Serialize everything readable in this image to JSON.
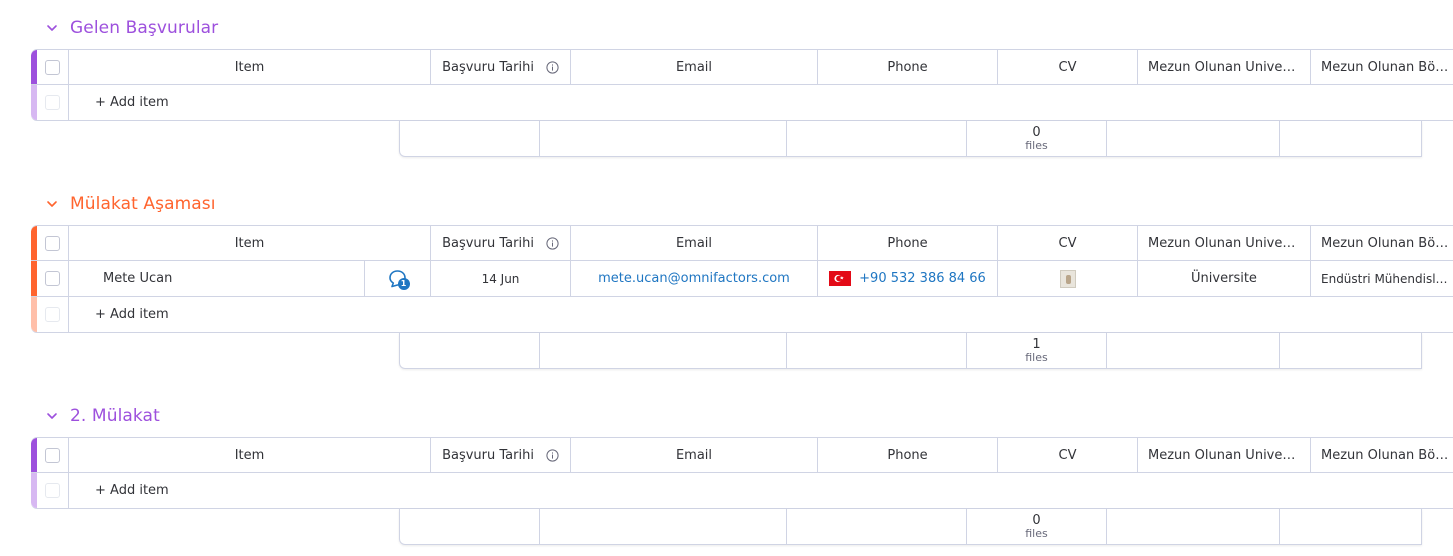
{
  "columns": {
    "item": "Item",
    "date": "Başvuru Tarihi",
    "email": "Email",
    "phone": "Phone",
    "cv": "CV",
    "university": "Mezun Olunan Üniversite",
    "department": "Mezun Olunan Bölüm"
  },
  "add_item_label": "+ Add item",
  "files_label": "files",
  "groups": [
    {
      "title": "Gelen Başvurular",
      "color": "#9d50dd",
      "file_count": "0"
    },
    {
      "title": "Mülakat Aşaması",
      "color": "#ff642e",
      "file_count": "1",
      "rows": [
        {
          "name": "Mete Ucan",
          "update_count": "1",
          "date": "14 Jun",
          "email": "mete.ucan@omnifactors.com",
          "phone": "+90 532 386 84 66",
          "phone_flag": "Turkey flag",
          "cv": "document-thumbnail",
          "university": "Üniversite",
          "department": "Endüstri Mühendisliği"
        }
      ]
    },
    {
      "title": "2. Mülakat",
      "color": "#9d50dd",
      "file_count": "0"
    }
  ]
}
